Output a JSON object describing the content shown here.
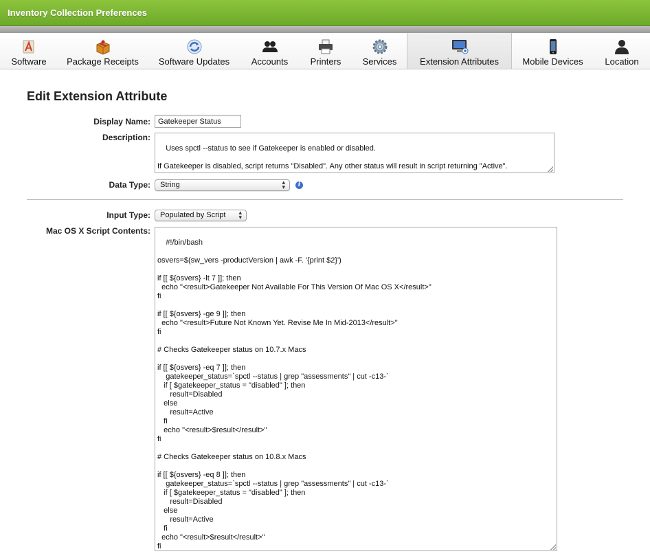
{
  "window": {
    "title": "Inventory Collection Preferences"
  },
  "tabs": [
    {
      "label": "Software",
      "icon": "software-icon",
      "active": false
    },
    {
      "label": "Package Receipts",
      "icon": "package-icon",
      "active": false
    },
    {
      "label": "Software Updates",
      "icon": "software-update-icon",
      "active": false
    },
    {
      "label": "Accounts",
      "icon": "accounts-icon",
      "active": false
    },
    {
      "label": "Printers",
      "icon": "printer-icon",
      "active": false
    },
    {
      "label": "Services",
      "icon": "gear-icon",
      "active": false
    },
    {
      "label": "Extension Attributes",
      "icon": "monitor-add-icon",
      "active": true
    },
    {
      "label": "Mobile Devices",
      "icon": "phone-icon",
      "active": false
    },
    {
      "label": "Location",
      "icon": "person-icon",
      "active": false
    }
  ],
  "form": {
    "heading": "Edit Extension Attribute",
    "display_name_label": "Display Name:",
    "display_name_value": "Gatekeeper Status",
    "description_label": "Description:",
    "description_value": "Uses spctl --status to see if Gatekeeper is enabled or disabled.\n\nIf Gatekeeper is disabled, script returns \"Disabled\". Any other status will result in script returning \"Active\".",
    "data_type_label": "Data Type:",
    "data_type_value": "String",
    "input_type_label": "Input Type:",
    "input_type_value": "Populated by Script",
    "script_label": "Mac OS X Script Contents:",
    "script_value": "#!/bin/bash\n\nosvers=$(sw_vers -productVersion | awk -F. '{print $2}')\n\nif [[ ${osvers} -lt 7 ]]; then\n  echo \"<result>Gatekeeper Not Available For This Version Of Mac OS X</result>\"\nfi\n\nif [[ ${osvers} -ge 9 ]]; then\n  echo \"<result>Future Not Known Yet. Revise Me In Mid-2013</result>\"\nfi\n\n# Checks Gatekeeper status on 10.7.x Macs\n\nif [[ ${osvers} -eq 7 ]]; then\n    gatekeeper_status=`spctl --status | grep \"assessments\" | cut -c13-`\n   if [ $gatekeeper_status = \"disabled\" ]; then\n      result=Disabled\n   else\n      result=Active\n   fi\n   echo \"<result>$result</result>\"\nfi\n\n# Checks Gatekeeper status on 10.8.x Macs\n\nif [[ ${osvers} -eq 8 ]]; then\n    gatekeeper_status=`spctl --status | grep \"assessments\" | cut -c13-`\n   if [ $gatekeeper_status = \"disabled\" ]; then\n      result=Disabled\n   else\n      result=Active\n   fi\n  echo \"<result>$result</result>\"\nfi"
  },
  "colors": {
    "titlebar": "#7cb734",
    "info_icon": "#3b6fd0"
  }
}
